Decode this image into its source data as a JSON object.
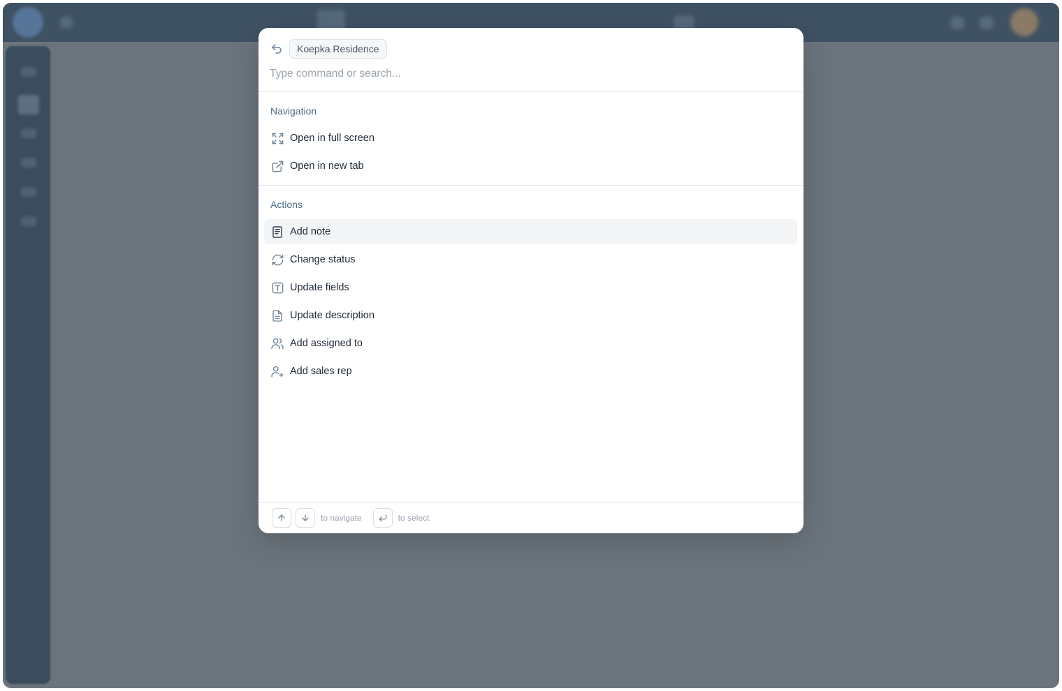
{
  "palette": {
    "context_chip": "Koepka Residence",
    "search_placeholder": "Type command or search...",
    "sections": {
      "navigation": {
        "title": "Navigation",
        "items": [
          {
            "label": "Open in full screen",
            "icon": "expand-icon"
          },
          {
            "label": "Open in new tab",
            "icon": "external-link-icon"
          }
        ]
      },
      "actions": {
        "title": "Actions",
        "items": [
          {
            "label": "Add note",
            "icon": "note-icon",
            "active": true
          },
          {
            "label": "Change status",
            "icon": "refresh-icon"
          },
          {
            "label": "Update fields",
            "icon": "text-field-icon"
          },
          {
            "label": "Update description",
            "icon": "document-icon"
          },
          {
            "label": "Add assigned to",
            "icon": "users-icon"
          },
          {
            "label": "Add sales rep",
            "icon": "user-plus-icon"
          }
        ]
      }
    },
    "footer": {
      "navigate_hint": "to navigate",
      "select_hint": "to select"
    }
  },
  "colors": {
    "accent_text": "#4a6a86",
    "icon": "#6f8396",
    "overlay": "#6b747c",
    "active_row": "#f3f4f6"
  }
}
